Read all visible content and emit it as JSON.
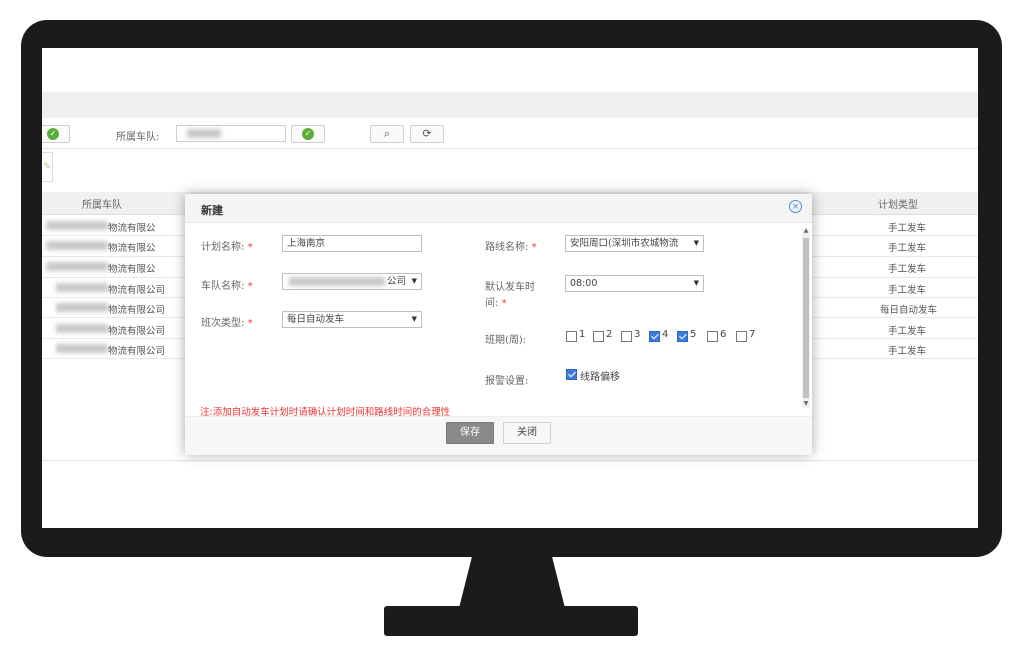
{
  "filters": {
    "fleet_label": "所属车队:",
    "fleet_value": "",
    "search_icon": "search-icon",
    "refresh_icon": "refresh-icon"
  },
  "table": {
    "columns": [
      "所属车队",
      "计划类型"
    ],
    "rows": [
      {
        "fleet": "物流有限公",
        "plan_type": "手工发车"
      },
      {
        "fleet": "物流有限公",
        "plan_type": "手工发车"
      },
      {
        "fleet": "物流有限公",
        "plan_type": "手工发车"
      },
      {
        "fleet": "物流有限公司",
        "plan_type": "手工发车"
      },
      {
        "fleet": "物流有限公司",
        "plan_type": "每日自动发车"
      },
      {
        "fleet": "物流有限公司",
        "plan_type": "手工发车"
      },
      {
        "fleet": "物流有限公司",
        "plan_type": "手工发车"
      }
    ]
  },
  "modal": {
    "title": "新建",
    "plan_name_label": "计划名称:",
    "plan_name_value": "上海南京",
    "fleet_name_label": "车队名称:",
    "fleet_name_value": "公司",
    "shift_type_label": "班次类型:",
    "shift_type_value": "每日自动发车",
    "route_name_label": "路线名称:",
    "route_name_value": "安阳周口(深圳市农城物流",
    "default_time_label_1": "默认发车时",
    "default_time_label_2": "间:",
    "default_time_value": "08:00",
    "schedule_label": "班期(周):",
    "weekdays": [
      {
        "num": "1",
        "checked": false
      },
      {
        "num": "2",
        "checked": false
      },
      {
        "num": "3",
        "checked": false
      },
      {
        "num": "4",
        "checked": true
      },
      {
        "num": "5",
        "checked": true
      },
      {
        "num": "6",
        "checked": false
      },
      {
        "num": "7",
        "checked": false
      }
    ],
    "alarm_label": "报警设置:",
    "route_offset_label": "线路偏移",
    "route_offset_checked": true,
    "required_mark": "*",
    "note": "注:添加自动发车计划时请确认计划时间和路线时间的合理性",
    "save_label": "保存",
    "close_label": "关闭"
  },
  "colors": {
    "accent": "#3b7ddd",
    "ok_green": "#5aaf3a",
    "required_red": "#e33333",
    "monitor": "#1b1b1b"
  }
}
